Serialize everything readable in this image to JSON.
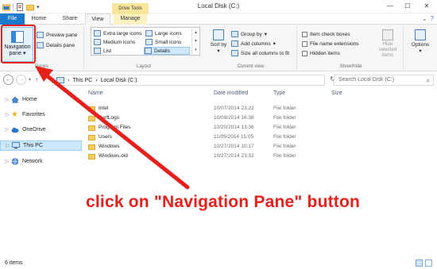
{
  "window": {
    "title": "Local Disk (C:)",
    "controls": [
      "—",
      "☐",
      "✕"
    ]
  },
  "ribbon_tabs": {
    "file": "File",
    "home": "Home",
    "share": "Share",
    "view": "View",
    "contextual_group": "Drive Tools",
    "manage": "Manage"
  },
  "ribbon": {
    "panes": {
      "navigation_pane": "Navigation pane",
      "preview_pane": "Preview pane",
      "details_pane": "Details pane",
      "group_label": "Panes"
    },
    "layout": {
      "extra_large_icons": "Extra large icons",
      "large_icons": "Large icons",
      "medium_icons": "Medium icons",
      "small_icons": "Small icons",
      "list": "List",
      "details": "Details",
      "group_label": "Layout"
    },
    "current_view": {
      "sort_by": "Sort by",
      "group_by": "Group by",
      "add_columns": "Add columns",
      "size_all_columns": "Size all columns to fit",
      "group_label": "Current view"
    },
    "show_hide": {
      "item_check_boxes": "Item check boxes",
      "file_name_extensions": "File name extensions",
      "hidden_items": "Hidden items",
      "hide_selected_items": "Hide selected items",
      "group_label": "Show/hide"
    },
    "options": "Options"
  },
  "address": {
    "path": [
      "This PC",
      "Local Disk (C:)"
    ],
    "search_placeholder": "Search Local Disk (C:)"
  },
  "nav_pane": {
    "items": [
      {
        "label": "Home",
        "icon": "home-icon"
      },
      {
        "label": "Favorites",
        "icon": "star-icon"
      },
      {
        "label": "OneDrive",
        "icon": "cloud-icon"
      },
      {
        "label": "This PC",
        "icon": "computer-icon",
        "selected": true
      },
      {
        "label": "Network",
        "icon": "network-icon"
      }
    ]
  },
  "file_list": {
    "columns": [
      "Name",
      "Date modified",
      "Type",
      "Size"
    ],
    "rows": [
      {
        "name": "Intel",
        "date": "10/07/2014 23:22",
        "type": "File folder",
        "size": ""
      },
      {
        "name": "PerfLogs",
        "date": "10/09/2014 16:38",
        "type": "File folder",
        "size": ""
      },
      {
        "name": "Program Files",
        "date": "10/20/2014 13:36",
        "type": "File folder",
        "size": ""
      },
      {
        "name": "Users",
        "date": "11/05/2014 15:05",
        "type": "File folder",
        "size": ""
      },
      {
        "name": "Windows",
        "date": "10/27/2014 10:17",
        "type": "File folder",
        "size": ""
      },
      {
        "name": "Windows.old",
        "date": "10/27/2014 23:32",
        "type": "File folder",
        "size": ""
      }
    ]
  },
  "status": {
    "item_count": "6 items"
  },
  "annotation": {
    "text": "click on \"Navigation Pane\" button",
    "color": "#e8201b"
  },
  "colors": {
    "file_tab": "#1979ca",
    "manage_tab": "#fcf2c2",
    "drive_tools": "#f8e79b",
    "selection": "#cce8ff"
  }
}
